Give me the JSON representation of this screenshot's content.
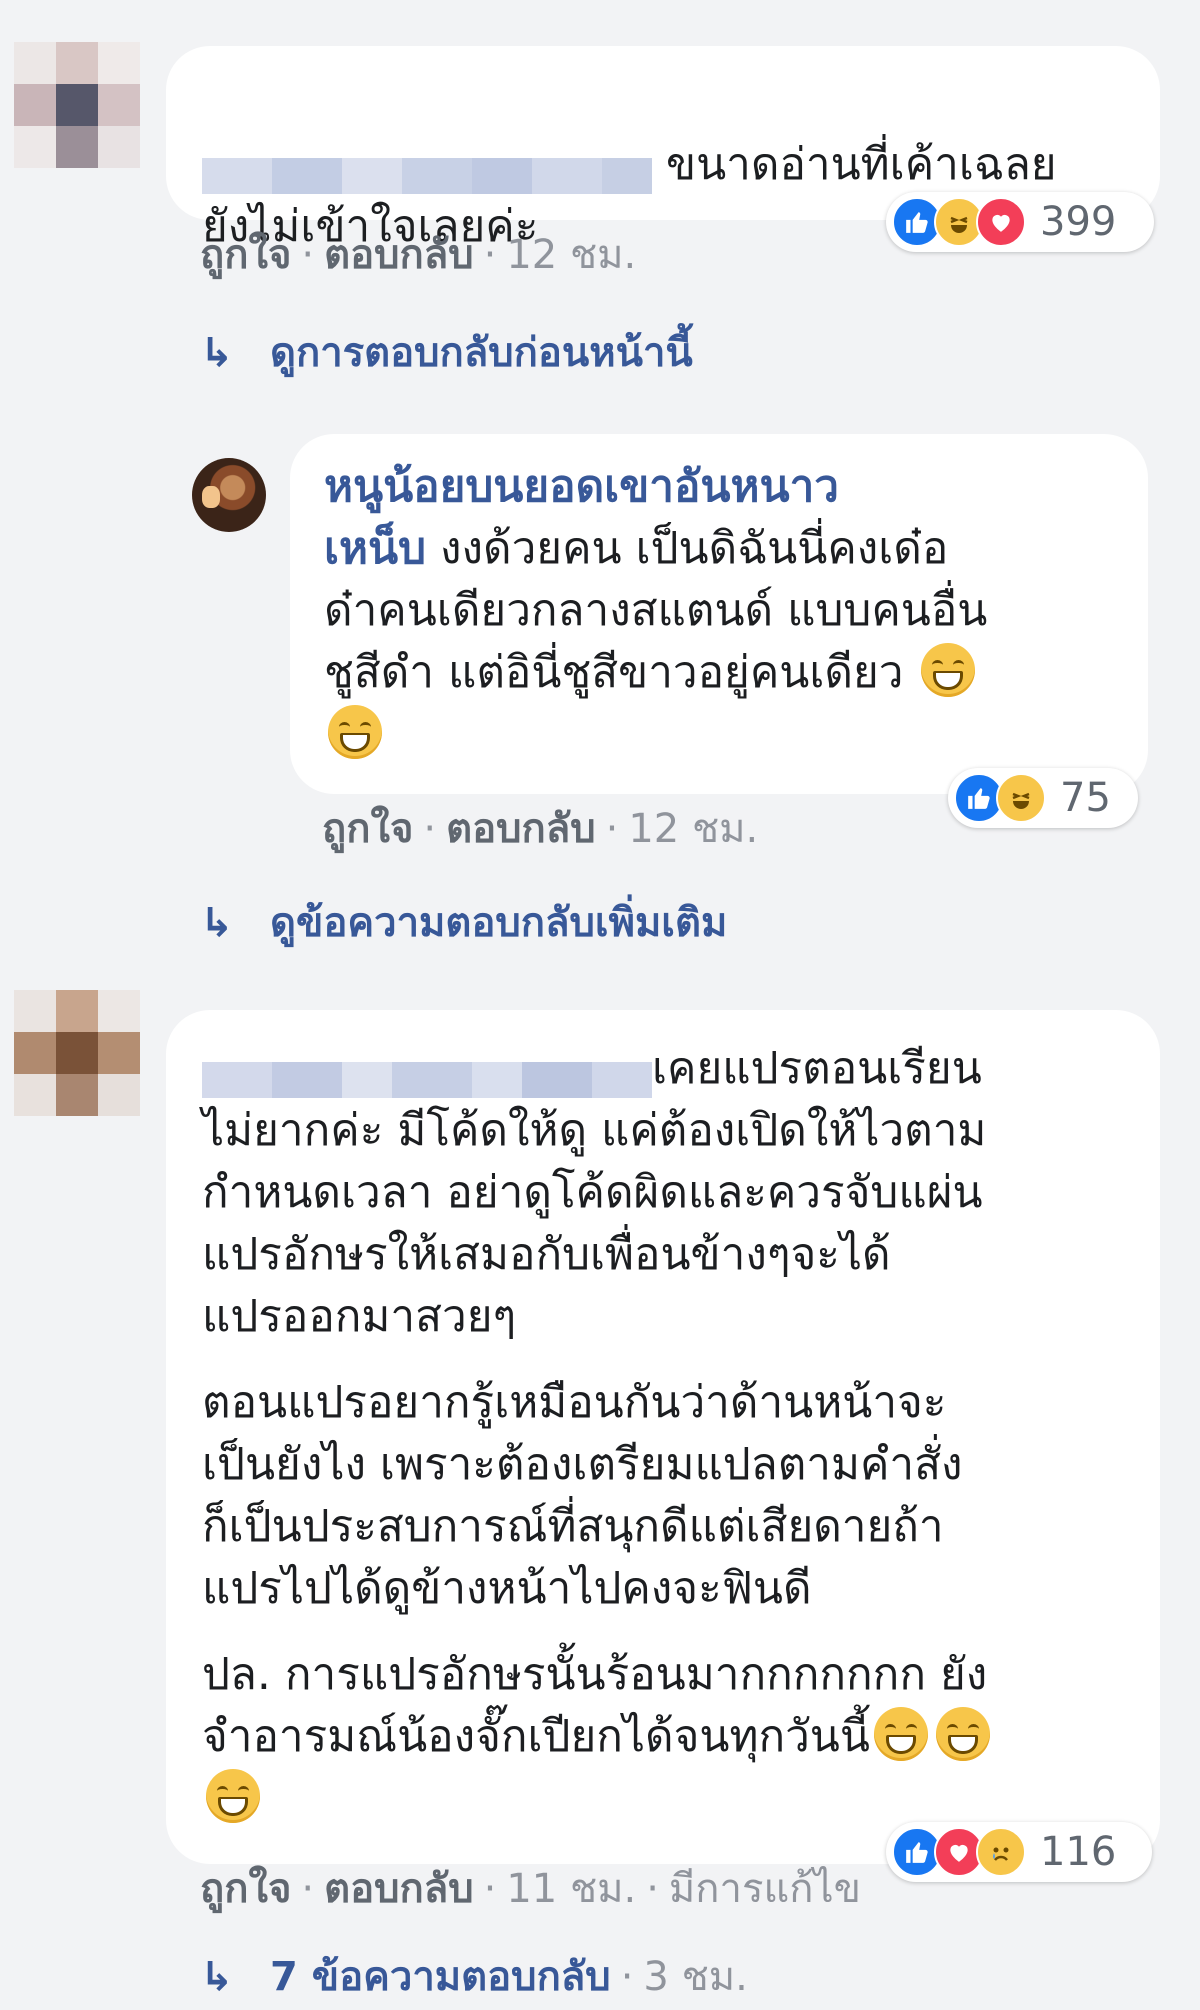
{
  "comments": [
    {
      "text_line1": "ขนาดอ่านที่เค้าเฉลย",
      "text_line2": "ยังไม่เข้าใจเลยค่ะ",
      "actions": {
        "like": "ถูกใจ",
        "reply": "ตอบกลับ",
        "time": "12 ชม."
      },
      "reactions": {
        "icons": [
          "like-icon",
          "haha-icon",
          "love-icon"
        ],
        "count": "399"
      },
      "view_replies": "ดูการตอบกลับก่อนหน้านี้"
    },
    {
      "author_line1": "หนูน้อยบนยอดเขาอันหนาว",
      "author_line2": "เหน็บ",
      "text_line2": " งงด้วยคน เป็นดิฉันนี่คงเด๋อ",
      "text_line3": "ด๋าคนเดียวกลางสแตนด์ แบบคนอื่น",
      "text_line4": "ชูสีดำ แต่อินี่ชูสีขาวอยู่คนเดียว",
      "actions": {
        "like": "ถูกใจ",
        "reply": "ตอบกลับ",
        "time": "12 ชม."
      },
      "reactions": {
        "icons": [
          "like-icon",
          "haha-icon"
        ],
        "count": "75"
      },
      "more_replies": "ดูข้อความตอบกลับเพิ่มเติม"
    },
    {
      "p1_line1": "เคยแปรตอนเรียน",
      "p1_line2": "ไม่ยากค่ะ มีโค้ดให้ดู แค่ต้องเปิดให้ไวตาม",
      "p1_line3": "กำหนดเวลา อย่าดูโค้ดผิดและควรจับแผ่น",
      "p1_line4": "แปรอักษรให้เสมอกับเพื่อนข้างๆจะได้",
      "p1_line5": "แปรออกมาสวยๆ",
      "p2_line1": "ตอนแปรอยากรู้เหมือนกันว่าด้านหน้าจะ",
      "p2_line2": "เป็นยังไง เพราะต้องเตรียมแปลตามคำสั่ง",
      "p2_line3": "ก็เป็นประสบการณ์ที่สนุกดีแต่เสียดายถ้า",
      "p2_line4": "แปรไปได้ดูข้างหน้าไปคงจะฟินดี",
      "p3_line1": "ปล. การแปรอักษรนั้นร้อนมากกกกกกก ยัง",
      "p3_line2": "จำอารมณ์น้องจั๊กเปียกได้จนทุกวันนี้",
      "actions": {
        "like": "ถูกใจ",
        "reply": "ตอบกลับ",
        "time": "11 ชม.",
        "edited": "มีการแก้ไข"
      },
      "reactions": {
        "icons": [
          "like-icon",
          "love-icon",
          "sad-icon"
        ],
        "count": "116"
      },
      "replies_count": "7 ข้อความตอบกลับ",
      "replies_time": "3 ชม."
    }
  ],
  "colors": {
    "background": "#f2f3f5",
    "bubble": "#ffffff",
    "link": "#385898",
    "meta": "#606770",
    "like": "#1877f2",
    "love": "#f33e58",
    "haha": "#f7c64a"
  }
}
